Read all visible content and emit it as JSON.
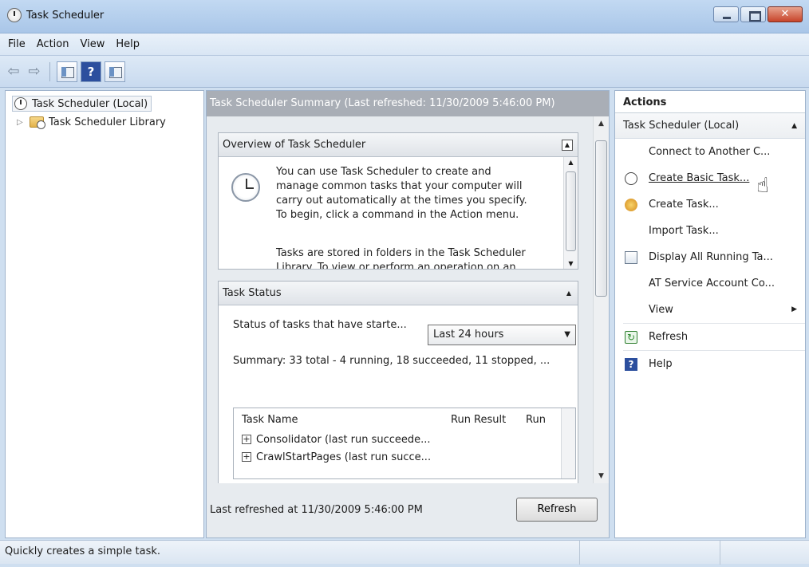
{
  "window": {
    "title": "Task Scheduler"
  },
  "menu": [
    "File",
    "Action",
    "View",
    "Help"
  ],
  "tree": {
    "root": "Task Scheduler (Local)",
    "child": "Task Scheduler Library"
  },
  "center": {
    "header": "Task Scheduler Summary (Last refreshed: 11/30/2009 5:46:00 PM)",
    "overview": {
      "title": "Overview of Task Scheduler",
      "para1_lines": [
        "You can use Task Scheduler to create and",
        "manage common tasks that your computer will",
        "carry out automatically at the times you specify.",
        "To begin, click a command in the Action menu."
      ],
      "para2_lines": [
        "Tasks are stored in folders in the Task Scheduler",
        "Library. To view or perform an operation on an"
      ]
    },
    "status": {
      "title": "Task Status",
      "filter_label": "Status of tasks that have starte...",
      "filter_value": "Last 24 hours",
      "summary": "Summary: 33 total - 4 running, 18 succeeded, 11 stopped, ...",
      "columns": [
        "Task Name",
        "Run Result",
        "Run"
      ],
      "rows": [
        "Consolidator (last run succeede...",
        "CrawlStartPages (last run succe..."
      ]
    },
    "footer": {
      "last_refreshed": "Last refreshed at 11/30/2009 5:46:00 PM",
      "refresh_label": "Refresh"
    }
  },
  "actions": {
    "title": "Actions",
    "group": "Task Scheduler (Local)",
    "items": [
      {
        "label": "Connect to Another C...",
        "icon": "none"
      },
      {
        "label": "Create Basic Task...",
        "icon": "clock-icon"
      },
      {
        "label": "Create Task...",
        "icon": "task-icon"
      },
      {
        "label": "Import Task...",
        "icon": "none"
      },
      {
        "label": "Display All Running Ta...",
        "icon": "running-tasks-icon"
      },
      {
        "label": "AT Service Account Co...",
        "icon": "none"
      },
      {
        "label": "View",
        "icon": "none"
      },
      {
        "label": "Refresh",
        "icon": "refresh-icon"
      },
      {
        "label": "Help",
        "icon": "help-icon"
      }
    ]
  },
  "statusbar": {
    "text": "Quickly creates a simple task."
  }
}
